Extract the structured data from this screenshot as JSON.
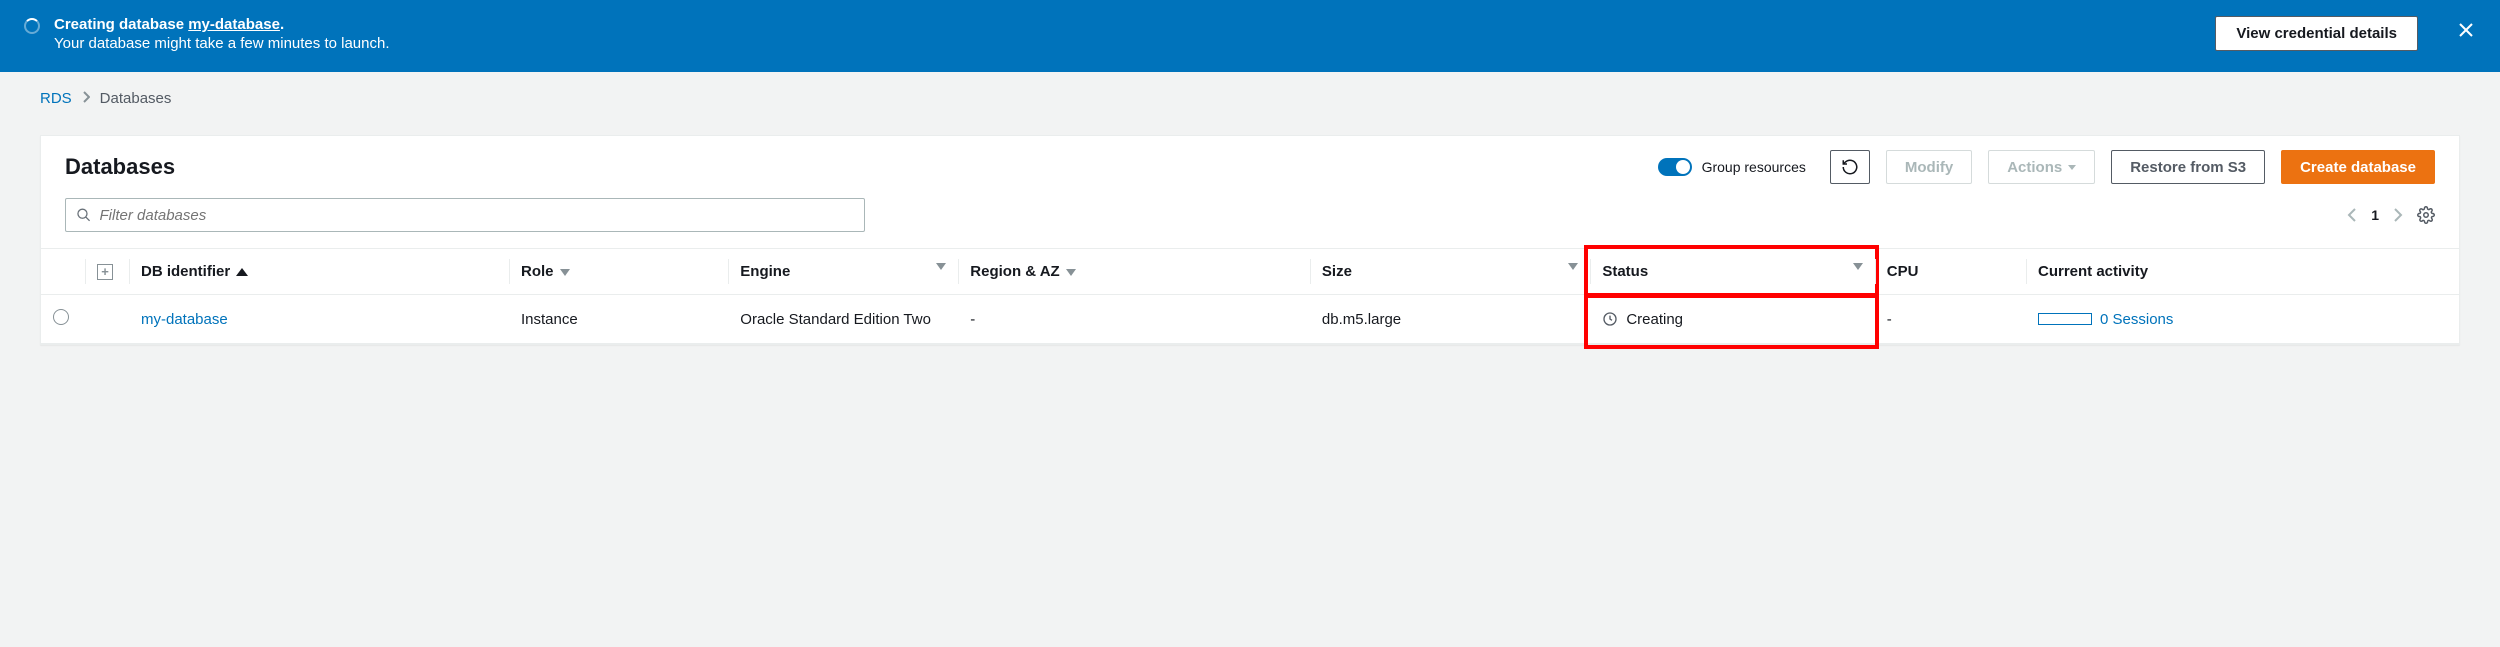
{
  "banner": {
    "title_prefix": "Creating database ",
    "db_name": "my-database",
    "title_suffix": ".",
    "subtitle": "Your database might take a few minutes to launch.",
    "credential_button": "View credential details"
  },
  "breadcrumbs": {
    "root": "RDS",
    "current": "Databases"
  },
  "panel": {
    "heading": "Databases",
    "toggle_label": "Group resources",
    "buttons": {
      "modify": "Modify",
      "actions": "Actions",
      "restore": "Restore from S3",
      "create": "Create database"
    },
    "filter_placeholder": "Filter databases",
    "page": "1"
  },
  "columns": {
    "db_identifier": "DB identifier",
    "role": "Role",
    "engine": "Engine",
    "region_az": "Region & AZ",
    "size": "Size",
    "status": "Status",
    "cpu": "CPU",
    "current_activity": "Current activity"
  },
  "rows": [
    {
      "db_identifier": "my-database",
      "role": "Instance",
      "engine": "Oracle Standard Edition Two",
      "region_az": "-",
      "size": "db.m5.large",
      "status": "Creating",
      "cpu": "-",
      "activity_sessions": "0 Sessions"
    }
  ]
}
